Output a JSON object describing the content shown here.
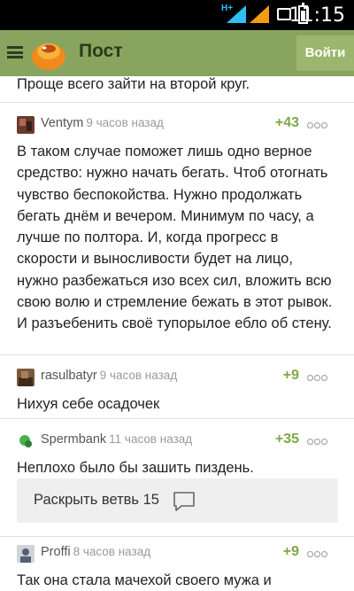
{
  "status_bar": {
    "time": "11:15",
    "network": "H+"
  },
  "toolbar": {
    "title": "Пост",
    "login_label": "Войти"
  },
  "feed": {
    "prev_comment_tail": "Проще всего зайти на второй круг.",
    "comments": [
      {
        "username": "Ventym",
        "time": "9 часов назад",
        "score": "+43",
        "text": "В таком случае поможет лишь одно верное средство: нужно начать бегать. Чтоб отогнать чувство беспокойства. Нужно продолжать бегать днём и вечером. Минимум по часу, а лучше по полтора. И, когда прогресс в скорости и выносливости будет на лицо, нужно разбежаться изо всех сил, вложить всю свою волю и стремление бежать в этот рывок. И разъебенить своё тупорылое ебло об стену."
      },
      {
        "username": "rasulbatyr",
        "time": "9 часов назад",
        "score": "+9",
        "text": "Нихуя себе осадочек"
      },
      {
        "username": "Spermbank",
        "time": "11 часов назад",
        "score": "+35",
        "text": "Неплохо было бы зашить пиздень."
      },
      {
        "username": "Proffi",
        "time": "8 часов назад",
        "score": "+9",
        "text": "Так она стала мачехой своего мужа и"
      }
    ],
    "expand_branch_label": "Раскрыть ветвь 15"
  },
  "colors": {
    "toolbar": "#88a45e",
    "login_button": "#9cb66d",
    "score": "#7ea846",
    "status_bar": "#000000"
  },
  "icons": [
    "menu-icon",
    "logo-icon",
    "more-dots-icon",
    "comment-bubble-icon",
    "signal-icon",
    "battery-icon"
  ]
}
